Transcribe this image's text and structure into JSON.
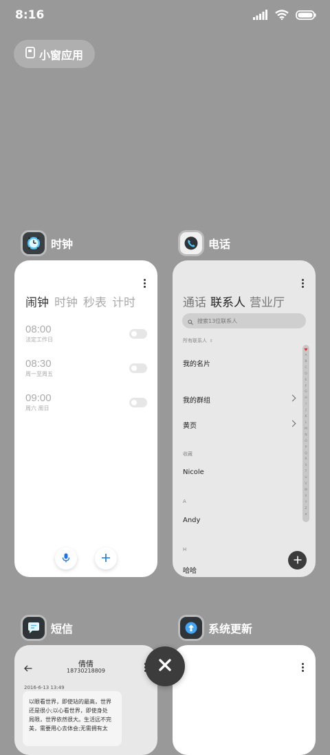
{
  "status_bar": {
    "time": "8:16",
    "icons": [
      "signal-icon",
      "wifi-icon",
      "battery-icon"
    ]
  },
  "small_window": {
    "label": "小窗应用",
    "icon": "small-window-icon"
  },
  "apps": {
    "clock": {
      "name": "时钟",
      "tabs": [
        "闹钟",
        "时钟",
        "秒表",
        "计时"
      ],
      "active_tab": "闹钟",
      "alarms": [
        {
          "time": "08:00",
          "desc": "法定工作日",
          "enabled": false
        },
        {
          "time": "08:30",
          "desc": "周一至周五",
          "enabled": false
        },
        {
          "time": "09:00",
          "desc": "周六 周日",
          "enabled": false
        }
      ]
    },
    "phone": {
      "name": "电话",
      "tabs": [
        "通话",
        "联系人",
        "营业厅"
      ],
      "active_tab": "联系人",
      "search_placeholder": "搜索13位联系人",
      "all_contacts_label": "所有联系人",
      "sections": {
        "favorites": "收藏",
        "a": "A",
        "h": "H"
      },
      "contacts": {
        "my_card": "我的名片",
        "my_groups": "我的群组",
        "yellow_pages": "黄页",
        "nicole": "Nicole",
        "andy": "Andy",
        "haha": "哈哈"
      },
      "index_letters": [
        "A",
        "B",
        "C",
        "D",
        "E",
        "F",
        "G",
        "H",
        "I",
        "J",
        "K",
        "L",
        "M",
        "N",
        "O",
        "P",
        "Q",
        "R",
        "S",
        "T",
        "U",
        "V",
        "W",
        "X",
        "Y",
        "Z",
        "#"
      ]
    },
    "messages": {
      "name": "短信",
      "contact_name": "倩倩",
      "contact_number": "18730218809",
      "date": "2016-6-13 13:49",
      "body_lines": [
        "以眼看世界，即使站的最高，世界",
        "还是很小;以心看世界，即使身处",
        "局限，世界依然很大。生活远不完",
        "美，需要用心去体会;无需拥有太"
      ]
    },
    "updater": {
      "name": "系统更新"
    }
  },
  "colors": {
    "background": "#999999",
    "dark_button": "#3c3c3c",
    "accent_blue": "#1a73e8",
    "heart_red": "#e53935"
  }
}
